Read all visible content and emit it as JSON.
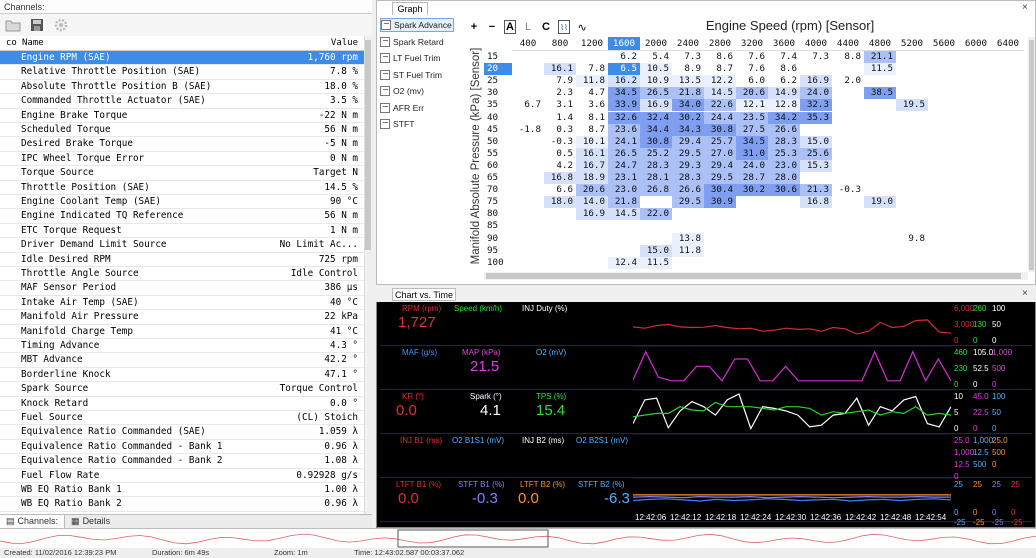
{
  "left_panel": {
    "title": "Channels:",
    "pin": "⊓",
    "col_co": "co",
    "col_name": "Name",
    "col_value": "Value",
    "channels": [
      {
        "name": "Engine RPM (SAE)",
        "value": "1,760 rpm",
        "selected": true
      },
      {
        "name": "Relative Throttle Position (SAE)",
        "value": "7.8 %"
      },
      {
        "name": "Absolute Throttle Position B (SAE)",
        "value": "18.0 %"
      },
      {
        "name": "Commanded Throttle Actuator (SAE)",
        "value": "3.5 %"
      },
      {
        "name": "Engine Brake Torque",
        "value": "-22 N m"
      },
      {
        "name": "Scheduled Torque",
        "value": "56 N m"
      },
      {
        "name": "Desired Brake Torque",
        "value": "-5 N m"
      },
      {
        "name": "IPC Wheel Torque Error",
        "value": "0 N m"
      },
      {
        "name": "Torque Source",
        "value": "Target N"
      },
      {
        "name": "Throttle Position (SAE)",
        "value": "14.5 %"
      },
      {
        "name": "Engine Coolant Temp (SAE)",
        "value": "90 °C"
      },
      {
        "name": "Engine Indicated TQ Reference",
        "value": "56 N m"
      },
      {
        "name": "ETC Torque Request",
        "value": "1 N m"
      },
      {
        "name": "Driver Demand Limit Source",
        "value": "No Limit Ac..."
      },
      {
        "name": "Idle Desired RPM",
        "value": "725 rpm"
      },
      {
        "name": "Throttle Angle Source",
        "value": "Idle Control"
      },
      {
        "name": "MAF Sensor Period",
        "value": "386 µs"
      },
      {
        "name": "Intake Air Temp (SAE)",
        "value": "40 °C"
      },
      {
        "name": "Manifold Air Pressure",
        "value": "22 kPa"
      },
      {
        "name": "Manifold Charge Temp",
        "value": "41 °C"
      },
      {
        "name": "Timing Advance",
        "value": "4.3 °"
      },
      {
        "name": "MBT Advance",
        "value": "42.2 °"
      },
      {
        "name": "Borderline Knock",
        "value": "47.1 °"
      },
      {
        "name": "Spark Source",
        "value": "Torque Control"
      },
      {
        "name": "Knock Retard",
        "value": "0.0 °"
      },
      {
        "name": "Fuel Source",
        "value": "(CL) Stoich"
      },
      {
        "name": "Equivalence Ratio Commanded (SAE)",
        "value": "1.059 λ"
      },
      {
        "name": "Equivalence Ratio Commanded - Bank 1",
        "value": "0.96 λ"
      },
      {
        "name": "Equivalence Ratio Commanded - Bank 2",
        "value": "1.08 λ"
      },
      {
        "name": "Fuel Flow Rate",
        "value": "0.92928 g/s"
      },
      {
        "name": "WB EQ Ratio Bank 1",
        "value": "1.00 λ"
      },
      {
        "name": "WB EQ Ratio Bank 2",
        "value": "0.96 λ"
      }
    ],
    "tabs": [
      {
        "label": "Channels:"
      },
      {
        "label": "Details"
      }
    ]
  },
  "graph_panel": {
    "tab": "Graph",
    "close": "×",
    "series": [
      "Spark Advance",
      "Spark Retard",
      "LT Fuel Trim",
      "ST Fuel Trim",
      "O2 (mv)",
      "AFR Err",
      "STFT"
    ],
    "tools": [
      "+",
      "−",
      "A",
      "L",
      "C",
      "⌇⌇",
      "∿"
    ],
    "title": "Engine Speed (rpm) [Sensor]",
    "y_label": "Manifold Absolute Pressure (kPa) [Sensor]",
    "columns": [
      "400",
      "800",
      "1200",
      "1600",
      "2000",
      "2400",
      "2800",
      "3200",
      "3600",
      "4000",
      "4400",
      "4800",
      "5200",
      "5600",
      "6000",
      "6400"
    ],
    "rows": [
      {
        "k": "15",
        "v": [
          "",
          "",
          "",
          "6.2",
          "5.4",
          "7.3",
          "8.6",
          "7.6",
          "7.4",
          "7.3",
          "8.8",
          "21.1",
          "",
          "",
          "",
          ""
        ]
      },
      {
        "k": "20",
        "v": [
          "",
          "16.1",
          "7.8",
          "6.5",
          "10.5",
          "8.9",
          "8.7",
          "7.6",
          "8.6",
          "",
          "",
          "11.5",
          "",
          "",
          "",
          ""
        ]
      },
      {
        "k": "25",
        "v": [
          "",
          "7.9",
          "11.8",
          "16.2",
          "10.9",
          "13.5",
          "12.2",
          "6.0",
          "6.2",
          "16.9",
          "2.0",
          "",
          "",
          "",
          "",
          ""
        ]
      },
      {
        "k": "30",
        "v": [
          "",
          "2.3",
          "4.7",
          "34.5",
          "26.5",
          "21.8",
          "14.5",
          "20.6",
          "14.9",
          "24.0",
          "",
          "38.5",
          "",
          "",
          "",
          ""
        ]
      },
      {
        "k": "35",
        "v": [
          "6.7",
          "3.1",
          "3.6",
          "33.9",
          "16.9",
          "34.0",
          "22.6",
          "12.1",
          "12.8",
          "32.3",
          "",
          "",
          "19.5",
          "",
          "",
          ""
        ]
      },
      {
        "k": "40",
        "v": [
          "",
          "1.4",
          "8.1",
          "32.6",
          "32.4",
          "30.2",
          "24.4",
          "23.5",
          "34.2",
          "35.3",
          "",
          "",
          "",
          "",
          "",
          ""
        ]
      },
      {
        "k": "45",
        "v": [
          "-1.8",
          "0.3",
          "8.7",
          "23.6",
          "34.4",
          "34.3",
          "30.8",
          "27.5",
          "26.6",
          "",
          "",
          "",
          "",
          "",
          "",
          ""
        ]
      },
      {
        "k": "50",
        "v": [
          "",
          "-0.3",
          "10.1",
          "24.1",
          "30.8",
          "29.4",
          "25.7",
          "34.5",
          "28.3",
          "15.0",
          "",
          "",
          "",
          "",
          "",
          ""
        ]
      },
      {
        "k": "55",
        "v": [
          "",
          "0.5",
          "16.1",
          "26.5",
          "25.2",
          "29.5",
          "27.0",
          "31.0",
          "25.3",
          "25.6",
          "",
          "",
          "",
          "",
          "",
          ""
        ]
      },
      {
        "k": "60",
        "v": [
          "",
          "4.2",
          "16.7",
          "24.7",
          "28.3",
          "29.3",
          "29.4",
          "24.0",
          "23.0",
          "15.3",
          "",
          "",
          "",
          "",
          "",
          ""
        ]
      },
      {
        "k": "65",
        "v": [
          "",
          "16.8",
          "18.9",
          "23.1",
          "28.1",
          "28.3",
          "29.5",
          "28.7",
          "28.0",
          "",
          "",
          "",
          "",
          "",
          "",
          ""
        ]
      },
      {
        "k": "70",
        "v": [
          "",
          "6.6",
          "20.6",
          "23.0",
          "26.8",
          "26.6",
          "30.4",
          "30.2",
          "30.6",
          "21.3",
          "-0.3",
          "",
          "",
          "",
          "",
          ""
        ]
      },
      {
        "k": "75",
        "v": [
          "",
          "18.0",
          "14.0",
          "21.8",
          "",
          "29.5",
          "30.9",
          "",
          "",
          "16.8",
          "",
          "19.0",
          "",
          "",
          "",
          ""
        ]
      },
      {
        "k": "80",
        "v": [
          "",
          "",
          "16.9",
          "14.5",
          "22.0",
          "",
          "",
          "",
          "",
          "",
          "",
          "",
          "",
          "",
          "",
          ""
        ]
      },
      {
        "k": "85",
        "v": [
          "",
          "",
          "",
          "",
          "",
          "",
          "",
          "",
          "",
          "",
          "",
          "",
          "",
          "",
          "",
          ""
        ]
      },
      {
        "k": "90",
        "v": [
          "",
          "",
          "",
          "",
          "",
          "13.8",
          "",
          "",
          "",
          "",
          "",
          "",
          "9.8",
          "",
          "",
          ""
        ]
      },
      {
        "k": "95",
        "v": [
          "",
          "",
          "",
          "",
          "15.0",
          "11.8",
          "",
          "",
          "",
          "",
          "",
          "",
          "",
          "",
          "",
          ""
        ]
      },
      {
        "k": "100",
        "v": [
          "",
          "",
          "",
          "12.4",
          "11.5",
          "",
          "",
          "",
          "",
          "",
          "",
          "",
          "",
          "",
          "",
          ""
        ]
      }
    ]
  },
  "chart_panel": {
    "tab": "Chart vs. Time",
    "close": "×",
    "lanes": [
      {
        "labels": [
          {
            "t": "RPM (rpm)",
            "c": "#e03030"
          },
          {
            "t": "Speed (km/h)",
            "c": "#30e030"
          },
          {
            "t": "INJ Duty (%)",
            "c": "#ffffff"
          }
        ],
        "values": [
          {
            "t": "1,727",
            "c": "#e03030"
          }
        ]
      },
      {
        "labels": [
          {
            "t": "MAF (g/s)",
            "c": "#4090ff"
          },
          {
            "t": "MAP (kPa)",
            "c": "#e040e0"
          },
          {
            "t": "O2 (mV)",
            "c": "#50b0ff"
          }
        ],
        "values": [
          {
            "t": "21.5",
            "c": "#e040e0"
          }
        ]
      },
      {
        "labels": [
          {
            "t": "KR (°)",
            "c": "#e03030"
          },
          {
            "t": "Spark (°)",
            "c": "#ffffff"
          },
          {
            "t": "TPS (%)",
            "c": "#30e030"
          }
        ],
        "values": [
          {
            "t": "0.0",
            "c": "#e03030"
          },
          {
            "t": "4.1",
            "c": "#ffffff"
          },
          {
            "t": "15.4",
            "c": "#30e030"
          }
        ]
      },
      {
        "labels": [
          {
            "t": "INJ B1 (ms)",
            "c": "#e03030"
          },
          {
            "t": "O2 B1S1 (mV)",
            "c": "#50b0ff"
          },
          {
            "t": "INJ B2 (ms)",
            "c": "#ffffff"
          },
          {
            "t": "O2 B2S1 (mV)",
            "c": "#50b0ff"
          }
        ],
        "values": []
      },
      {
        "labels": [
          {
            "t": "LTFT B1 (%)",
            "c": "#e03030"
          },
          {
            "t": "STFT B1 (%)",
            "c": "#8080ff"
          },
          {
            "t": "LTFT B2 (%)",
            "c": "#ff9020"
          },
          {
            "t": "STFT B2 (%)",
            "c": "#50b0ff"
          }
        ],
        "values": [
          {
            "t": "0.0",
            "c": "#e03030"
          },
          {
            "t": "-0.3",
            "c": "#8080ff"
          },
          {
            "t": "0.0",
            "c": "#ff9020"
          },
          {
            "t": "-6.3",
            "c": "#50b0ff"
          }
        ]
      }
    ],
    "scales": [
      [
        "6,000",
        "260",
        "100",
        "3,000",
        "130",
        "50",
        "0",
        "0",
        "0"
      ],
      [
        "460",
        "105.0",
        "1,000",
        "230",
        "52.5",
        "500",
        "0",
        "0",
        "0"
      ],
      [
        "10",
        "45.0",
        "100",
        "5",
        "22.5",
        "50",
        "0",
        "0",
        "0"
      ],
      [
        "25.0",
        "1,000",
        "25.0",
        "1,000",
        "12.5",
        "500",
        "12.5",
        "500",
        "0",
        "0"
      ],
      [
        "25",
        "25",
        "25",
        "25",
        "0",
        "0",
        "0",
        "0",
        "-25",
        "-25",
        "-25",
        "-25"
      ]
    ],
    "times": [
      "12:42:06",
      "12:42:12",
      "12:42:18",
      "12:42:24",
      "12:42:30",
      "12:42:36",
      "12:42:42",
      "12:42:48",
      "12:42:54"
    ],
    "chart_data": [
      {
        "type": "line",
        "title": "",
        "series": [
          {
            "name": "RPM (rpm)",
            "values": [
              2700,
              2500,
              2900,
              3100,
              2700,
              2600,
              2650,
              2900,
              2600,
              2400,
              2500,
              2000,
              2200,
              2500,
              2300,
              2400,
              2000,
              2600,
              2400,
              1600,
              2000,
              3400,
              2600,
              2800,
              3700,
              3800,
              1900,
              1700
            ]
          }
        ],
        "ylim": [
          0,
          6000
        ]
      },
      {
        "type": "line",
        "title": "",
        "series": [
          {
            "name": "MAP (kPa)",
            "values": [
              22,
              100,
              30,
              20,
              20,
              60,
              60,
              20,
              80,
              80,
              20,
              20,
              60,
              20,
              20,
              20,
              20,
              20,
              20,
              100,
              20,
              20,
              100,
              20,
              80,
              20
            ]
          }
        ],
        "ylim": [
          0,
          105
        ]
      },
      {
        "type": "line",
        "title": "",
        "series": [
          {
            "name": "Spark (°)",
            "values": [
              10,
              38,
              40,
              5,
              25,
              36,
              30,
              20,
              38,
              45,
              4,
              30,
              28,
              25,
              20,
              6,
              8,
              20,
              22,
              40,
              8,
              30,
              25,
              38,
              42,
              10,
              6,
              30
            ]
          },
          {
            "name": "TPS (%)",
            "values": [
              18,
              20,
              22,
              22,
              30,
              26,
              25,
              35,
              30,
              30,
              30,
              28,
              26,
              30,
              30,
              28,
              20,
              24,
              22,
              24,
              26,
              20,
              24,
              22,
              30,
              20,
              22,
              20
            ]
          }
        ],
        "ylim": [
          0,
          45
        ]
      },
      {
        "type": "line",
        "title": "",
        "series": [
          {
            "name": "STFT B2 (%)",
            "values": [
              -8,
              -6,
              -5,
              -7,
              -9,
              -6,
              -8,
              -7,
              -5,
              -6,
              -8,
              -7,
              -6,
              -9,
              -7,
              -6,
              -8,
              -6,
              -5,
              -7
            ]
          },
          {
            "name": "STFT B1 (%)",
            "values": [
              -2,
              -1,
              -2,
              -3,
              -1,
              -2,
              -2,
              -1,
              -3,
              -2,
              -1,
              -2,
              -3,
              -2,
              -1,
              -2,
              -2,
              -1,
              -2,
              -2
            ]
          },
          {
            "name": "LTFT B2 (%)",
            "values": [
              2,
              2,
              2,
              2,
              2,
              2,
              2,
              2,
              2,
              2,
              2,
              2,
              2,
              2,
              2,
              2,
              2,
              2,
              2,
              2
            ]
          }
        ],
        "ylim": [
          -25,
          25
        ]
      }
    ]
  },
  "status": {
    "created": "Created: 11/02/2016 12:39:23 PM",
    "duration": "Duration: 6m 49s",
    "zoom": "Zoom: 1m",
    "time": "Time: 12:43:02.587  00:03:37.062"
  }
}
